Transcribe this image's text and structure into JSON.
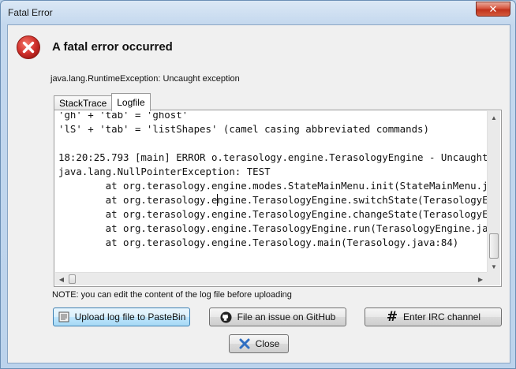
{
  "window": {
    "title": "Fatal Error"
  },
  "header": {
    "heading": "A fatal error occurred",
    "icon": "error-icon"
  },
  "exception": "java.lang.RuntimeException: Uncaught exception",
  "tabs": [
    {
      "label": "StackTrace",
      "active": false
    },
    {
      "label": "Logfile",
      "active": true
    }
  ],
  "log_lines": [
    "'gh' + 'tab' = 'ghost'",
    "'lS' + 'tab' = 'listShapes' (camel casing abbreviated commands)",
    "",
    "18:20:25.793 [main] ERROR o.terasology.engine.TerasologyEngine - Uncaught",
    "java.lang.NullPointerException: TEST",
    "        at org.terasology.engine.modes.StateMainMenu.init(StateMainMenu.java",
    "        at org.terasology.engine.TerasologyEngine.switchState(TerasologyEng",
    "        at org.terasology.engine.TerasologyEngine.changeState(TerasologyEng",
    "        at org.terasology.engine.TerasologyEngine.run(TerasologyEngine.java",
    "        at org.terasology.engine.Terasology.main(Terasology.java:84)"
  ],
  "note": "NOTE: you can edit the content of the log file before uploading",
  "buttons": {
    "pastebin": "Upload log file to PasteBin",
    "github": "File an issue on GitHub",
    "irc": "Enter IRC channel",
    "close": "Close"
  },
  "icons": {
    "pastebin": "pastebin-icon",
    "github": "github-icon",
    "irc": "hash-icon",
    "close": "close-x-icon"
  },
  "colors": {
    "error_red": "#d0312d",
    "close_blue": "#2f6fc2"
  }
}
